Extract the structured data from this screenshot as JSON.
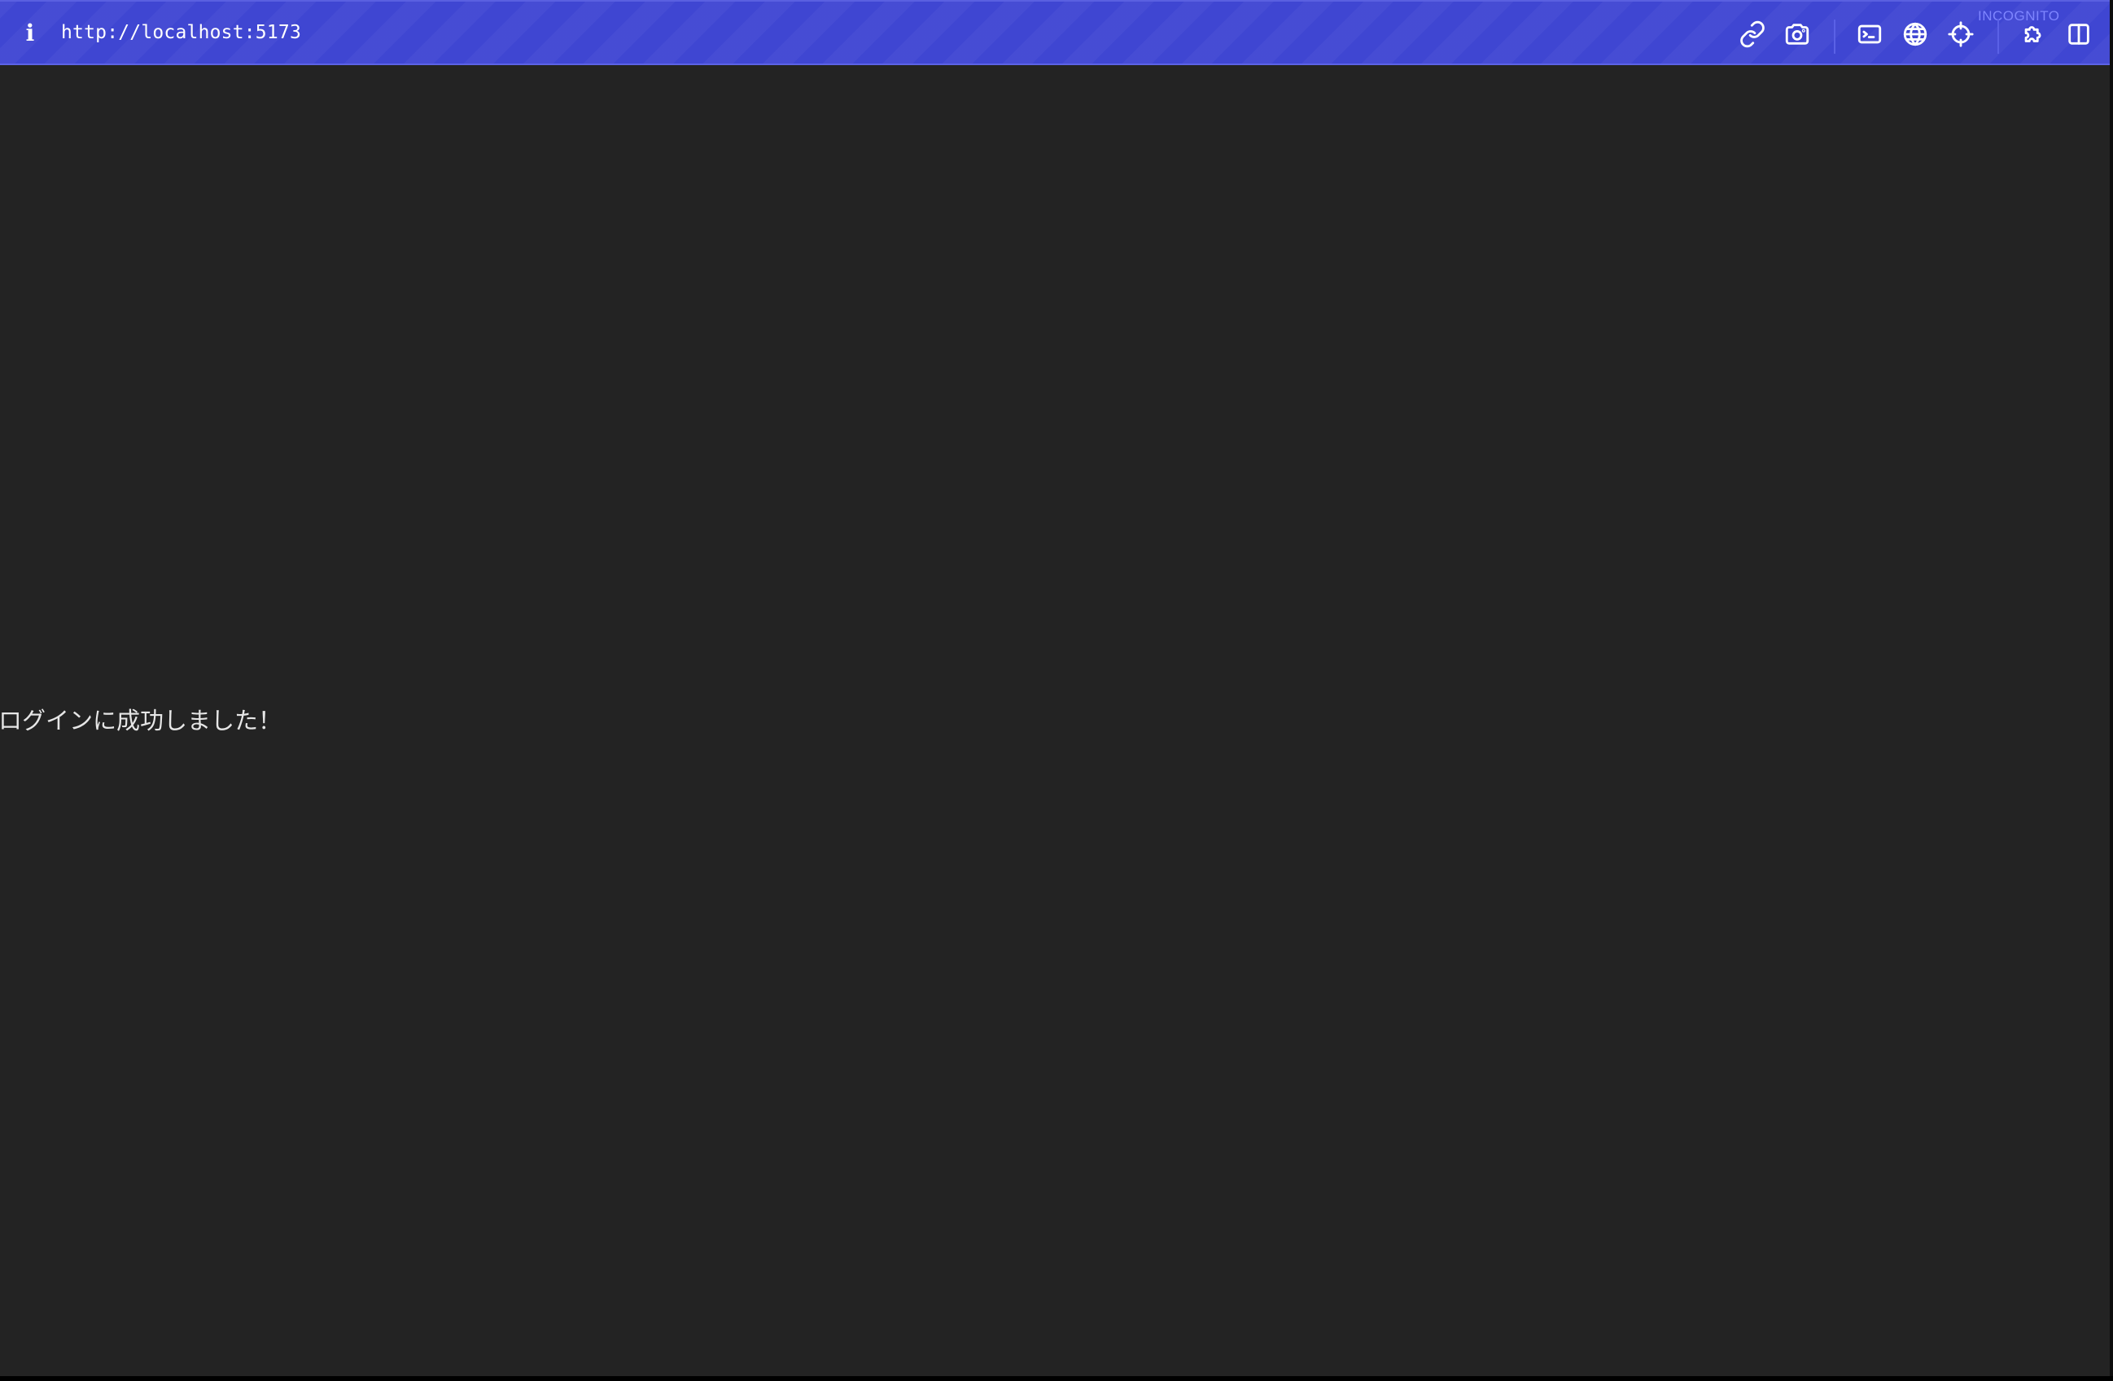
{
  "toolbar": {
    "info_icon": "info-icon",
    "info_glyph": "i",
    "url": "http://localhost:5173",
    "mode_label": "INCOGNITO",
    "buttons": [
      {
        "name": "copy-link-button",
        "icon": "link-icon"
      },
      {
        "name": "screenshot-button",
        "icon": "camera-icon"
      },
      {
        "name": "console-button",
        "icon": "terminal-icon"
      },
      {
        "name": "network-button",
        "icon": "globe-icon"
      },
      {
        "name": "inspect-button",
        "icon": "crosshair-icon"
      },
      {
        "name": "extensions-button",
        "icon": "puzzle-icon"
      },
      {
        "name": "split-view-button",
        "icon": "sidebar-icon"
      }
    ]
  },
  "page": {
    "message": "ログインに成功しました！",
    "background_color": "#232323",
    "text_color": "#e6e6e6"
  },
  "colors": {
    "toolbar_accent": "#3f46d2",
    "incognito_label": "#7e85ff"
  }
}
